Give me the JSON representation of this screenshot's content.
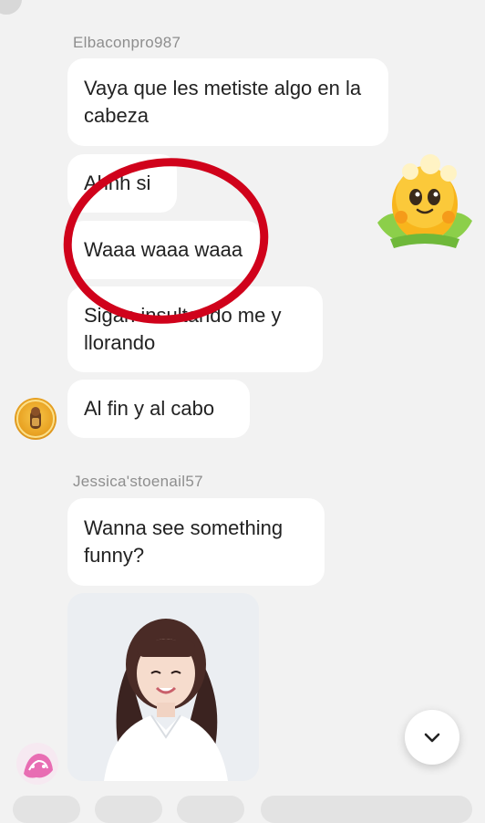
{
  "messages": {
    "group1": {
      "sender": "Elbaconpro987",
      "texts": [
        "Vaya que les metiste algo en la cabeza",
        "Ahhh si",
        "Waaa waaa waaa",
        "Sigan insultando me y llorando",
        "Al fin y al cabo"
      ]
    },
    "group2": {
      "sender": "Jessica'stoenail57",
      "texts": [
        "Wanna see something funny?"
      ]
    }
  },
  "icons": {
    "scroll_down": "chevron-down-icon",
    "sticker": "corn-sticker",
    "annotation": "red-circle-annotation"
  },
  "colors": {
    "background": "#f2f2f2",
    "bubble": "#ffffff",
    "annotation_red": "#d0021b"
  }
}
